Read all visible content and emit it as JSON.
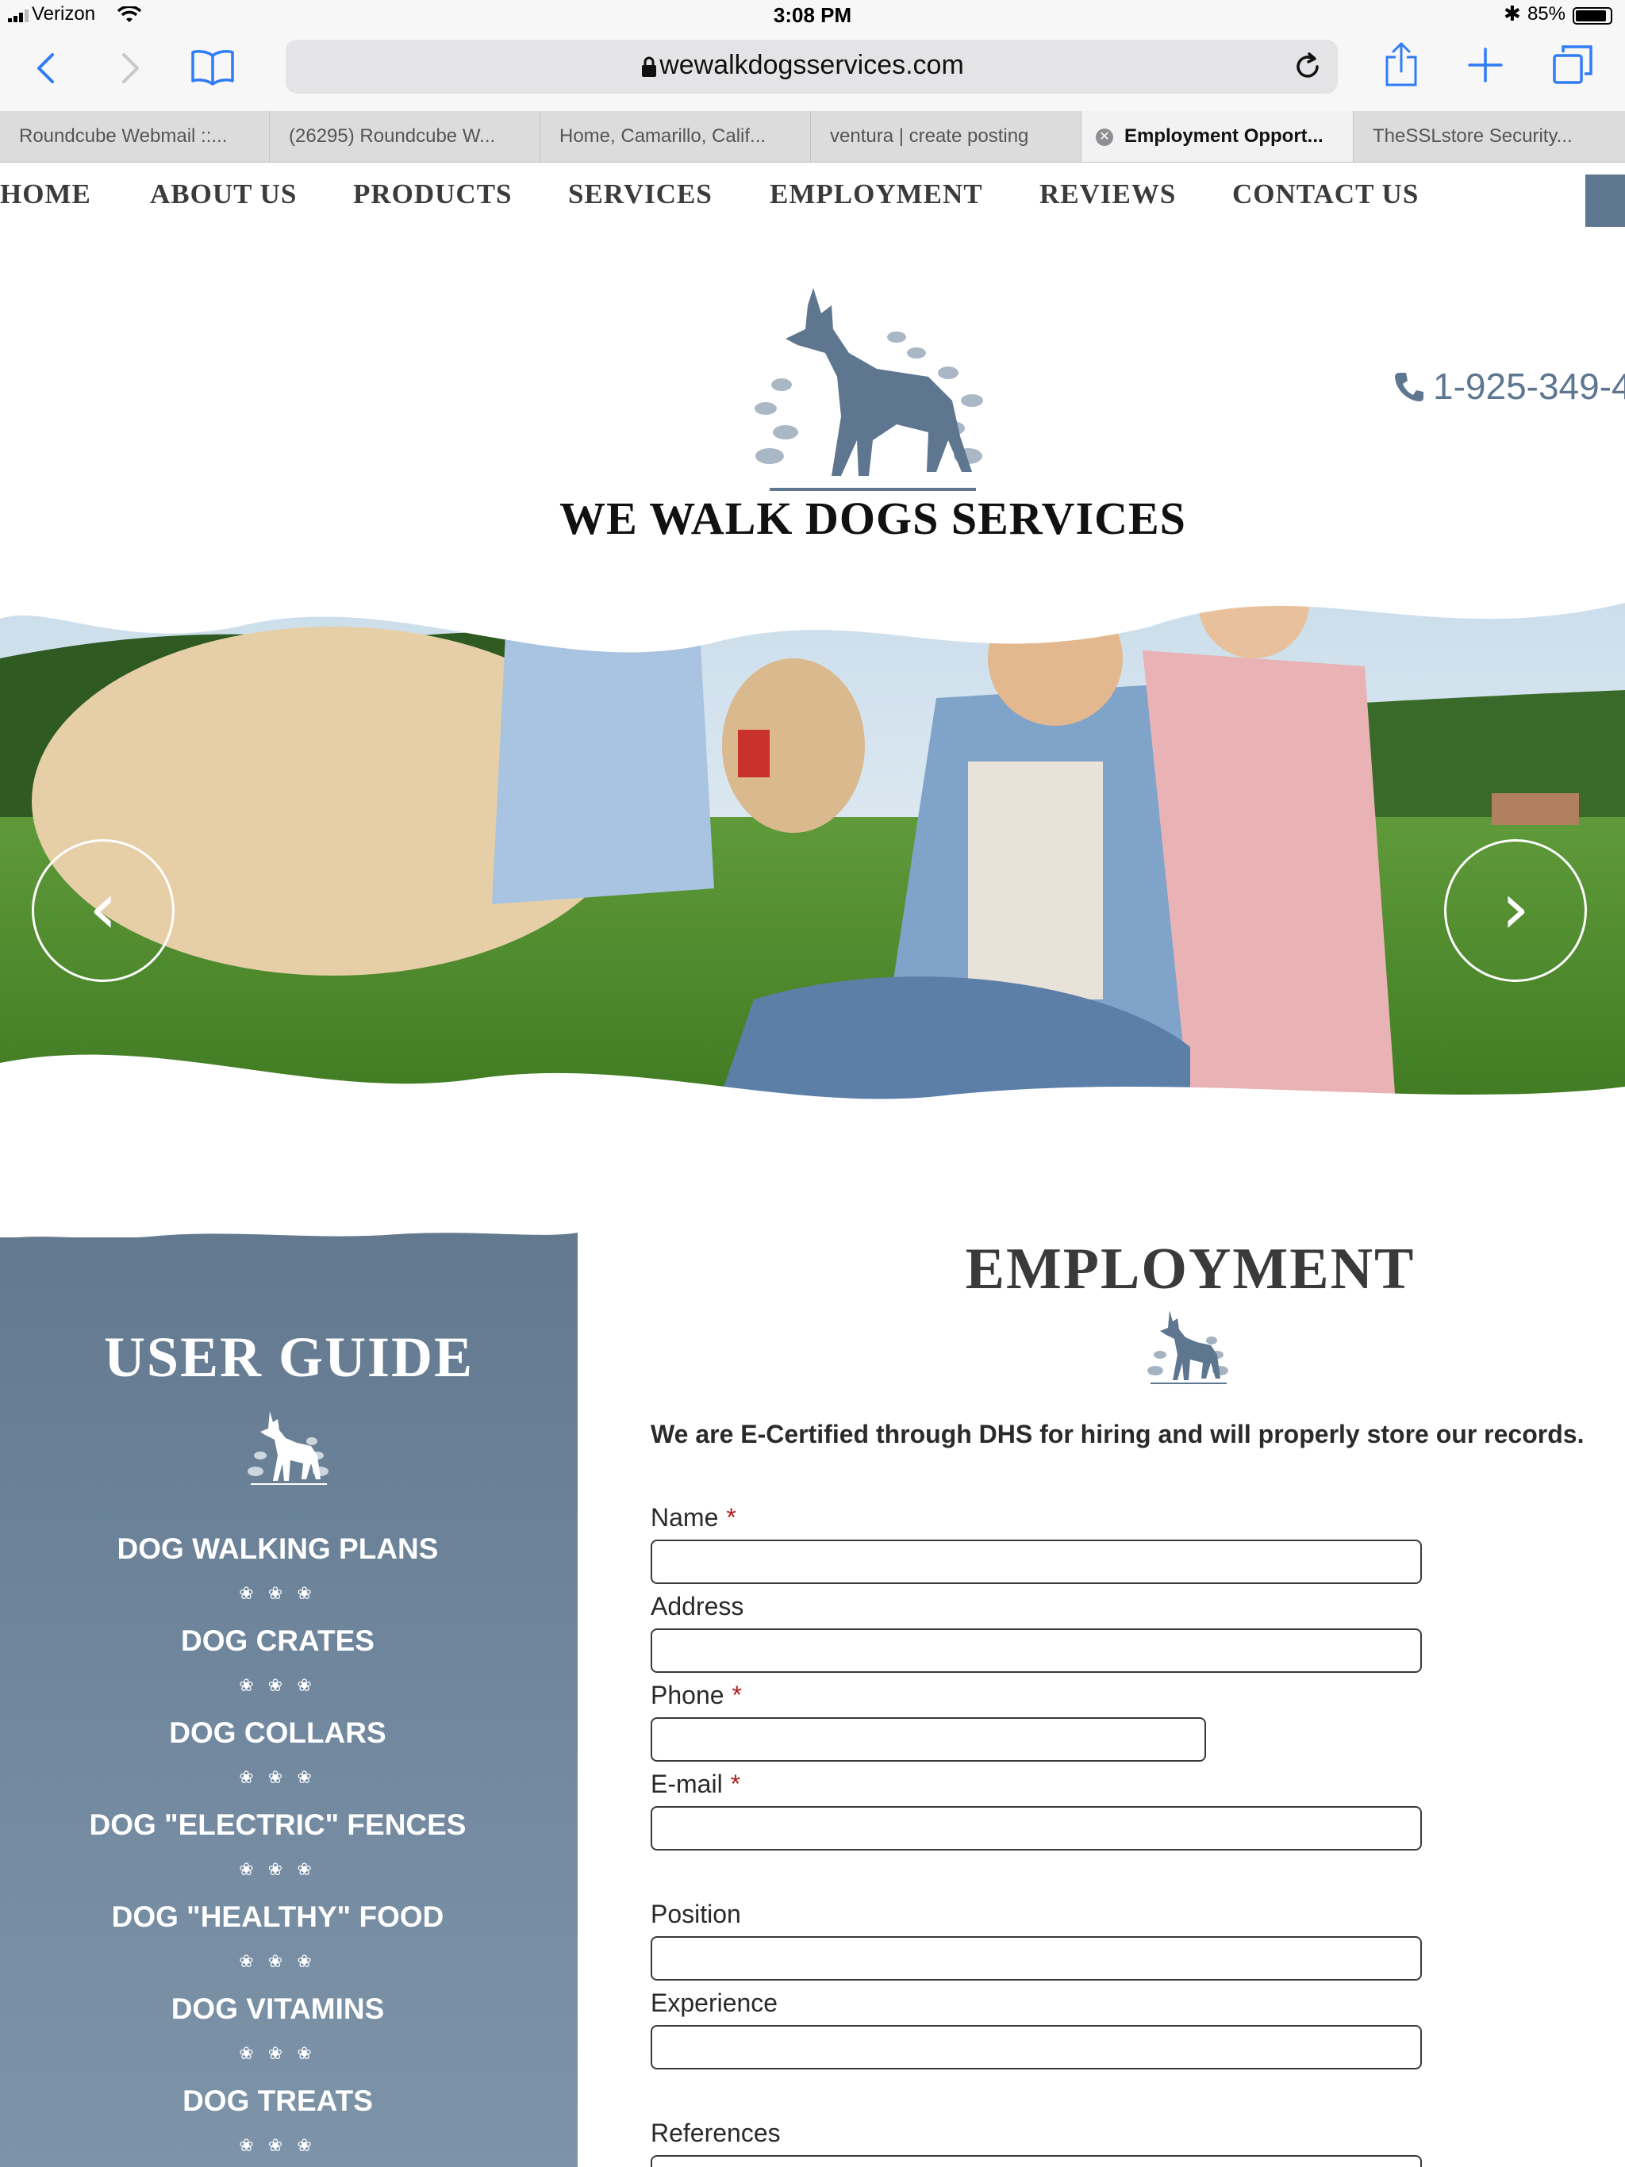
{
  "status_bar": {
    "carrier": "Verizon",
    "time": "3:08 PM",
    "battery": "85%"
  },
  "browser": {
    "url": "wewalkdogsservices.com",
    "tabs": [
      {
        "label": "Roundcube Webmail ::..."
      },
      {
        "label": "(26295) Roundcube W..."
      },
      {
        "label": "Home, Camarillo, Calif..."
      },
      {
        "label": "ventura | create posting"
      },
      {
        "label": "Employment Opport..."
      },
      {
        "label": "TheSSLstore Security..."
      }
    ]
  },
  "site": {
    "nav": [
      "HOME",
      "ABOUT US",
      "PRODUCTS",
      "SERVICES",
      "EMPLOYMENT",
      "REVIEWS",
      "CONTACT US"
    ],
    "logo_title": "WE WALK DOGS SERVICES",
    "phone": "1-925-349-4"
  },
  "sidebar": {
    "title": "USER GUIDE",
    "items": [
      "DOG WALKING PLANS",
      "DOG CRATES",
      "DOG COLLARS",
      "DOG \"ELECTRIC\" FENCES",
      "DOG \"HEALTHY\" FOOD",
      "DOG VITAMINS",
      "DOG TREATS"
    ]
  },
  "form": {
    "title": "EMPLOYMENT",
    "intro": "We are E-Certified through DHS for hiring and will properly store our records.",
    "fields": [
      {
        "label": "Name",
        "required": "*"
      },
      {
        "label": "Address"
      },
      {
        "label": "Phone",
        "required": "*"
      },
      {
        "label": "E-mail",
        "required": "*"
      },
      {
        "label": "Position"
      },
      {
        "label": "Experience"
      },
      {
        "label": "References"
      }
    ]
  },
  "colors": {
    "accent": "#5e7690",
    "ios_blue": "#2f7cf6",
    "required": "#b31b1b"
  }
}
